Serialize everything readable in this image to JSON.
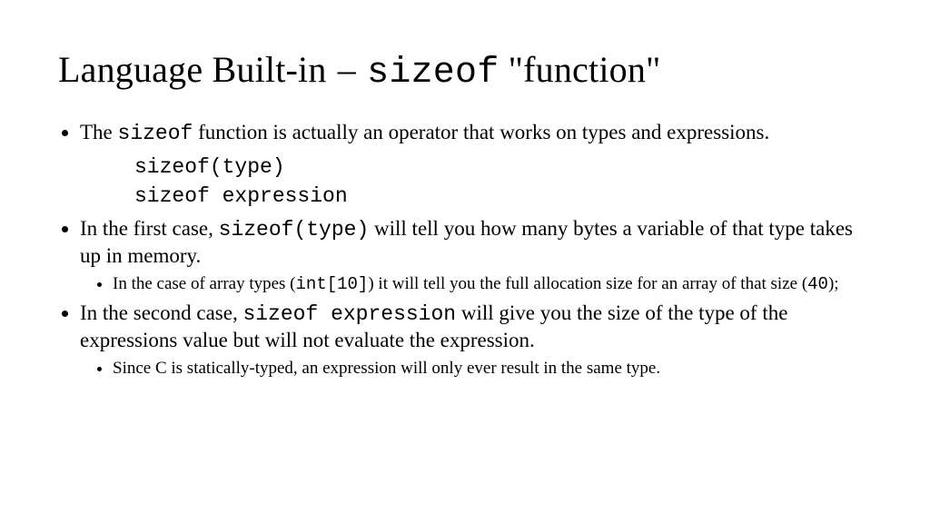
{
  "title": {
    "part1": "Language Built-in",
    "dash": "–",
    "code": "sizeof",
    "part2": "\"function\""
  },
  "bullets": {
    "b1": {
      "pre": "The ",
      "code": "sizeof",
      "post": " function is actually an operator that works on types and expressions."
    },
    "code1": "sizeof(type)",
    "code2": "sizeof expression",
    "b2": {
      "pre": "In the first case, ",
      "code": "sizeof(type)",
      "post": " will tell you how many bytes a variable of that type takes up in memory."
    },
    "b2sub": {
      "pre": "In the case of array types (",
      "code1": "int[10]",
      "mid": ") it will tell you the full allocation size for an array of that size (",
      "code2": "40",
      "post": ");"
    },
    "b3": {
      "pre": "In the second case, ",
      "code": "sizeof expression",
      "post": " will give you the size of the type of the expressions value but will not evaluate the expression."
    },
    "b3sub": "Since C is statically-typed, an expression will only ever result in the same type."
  }
}
